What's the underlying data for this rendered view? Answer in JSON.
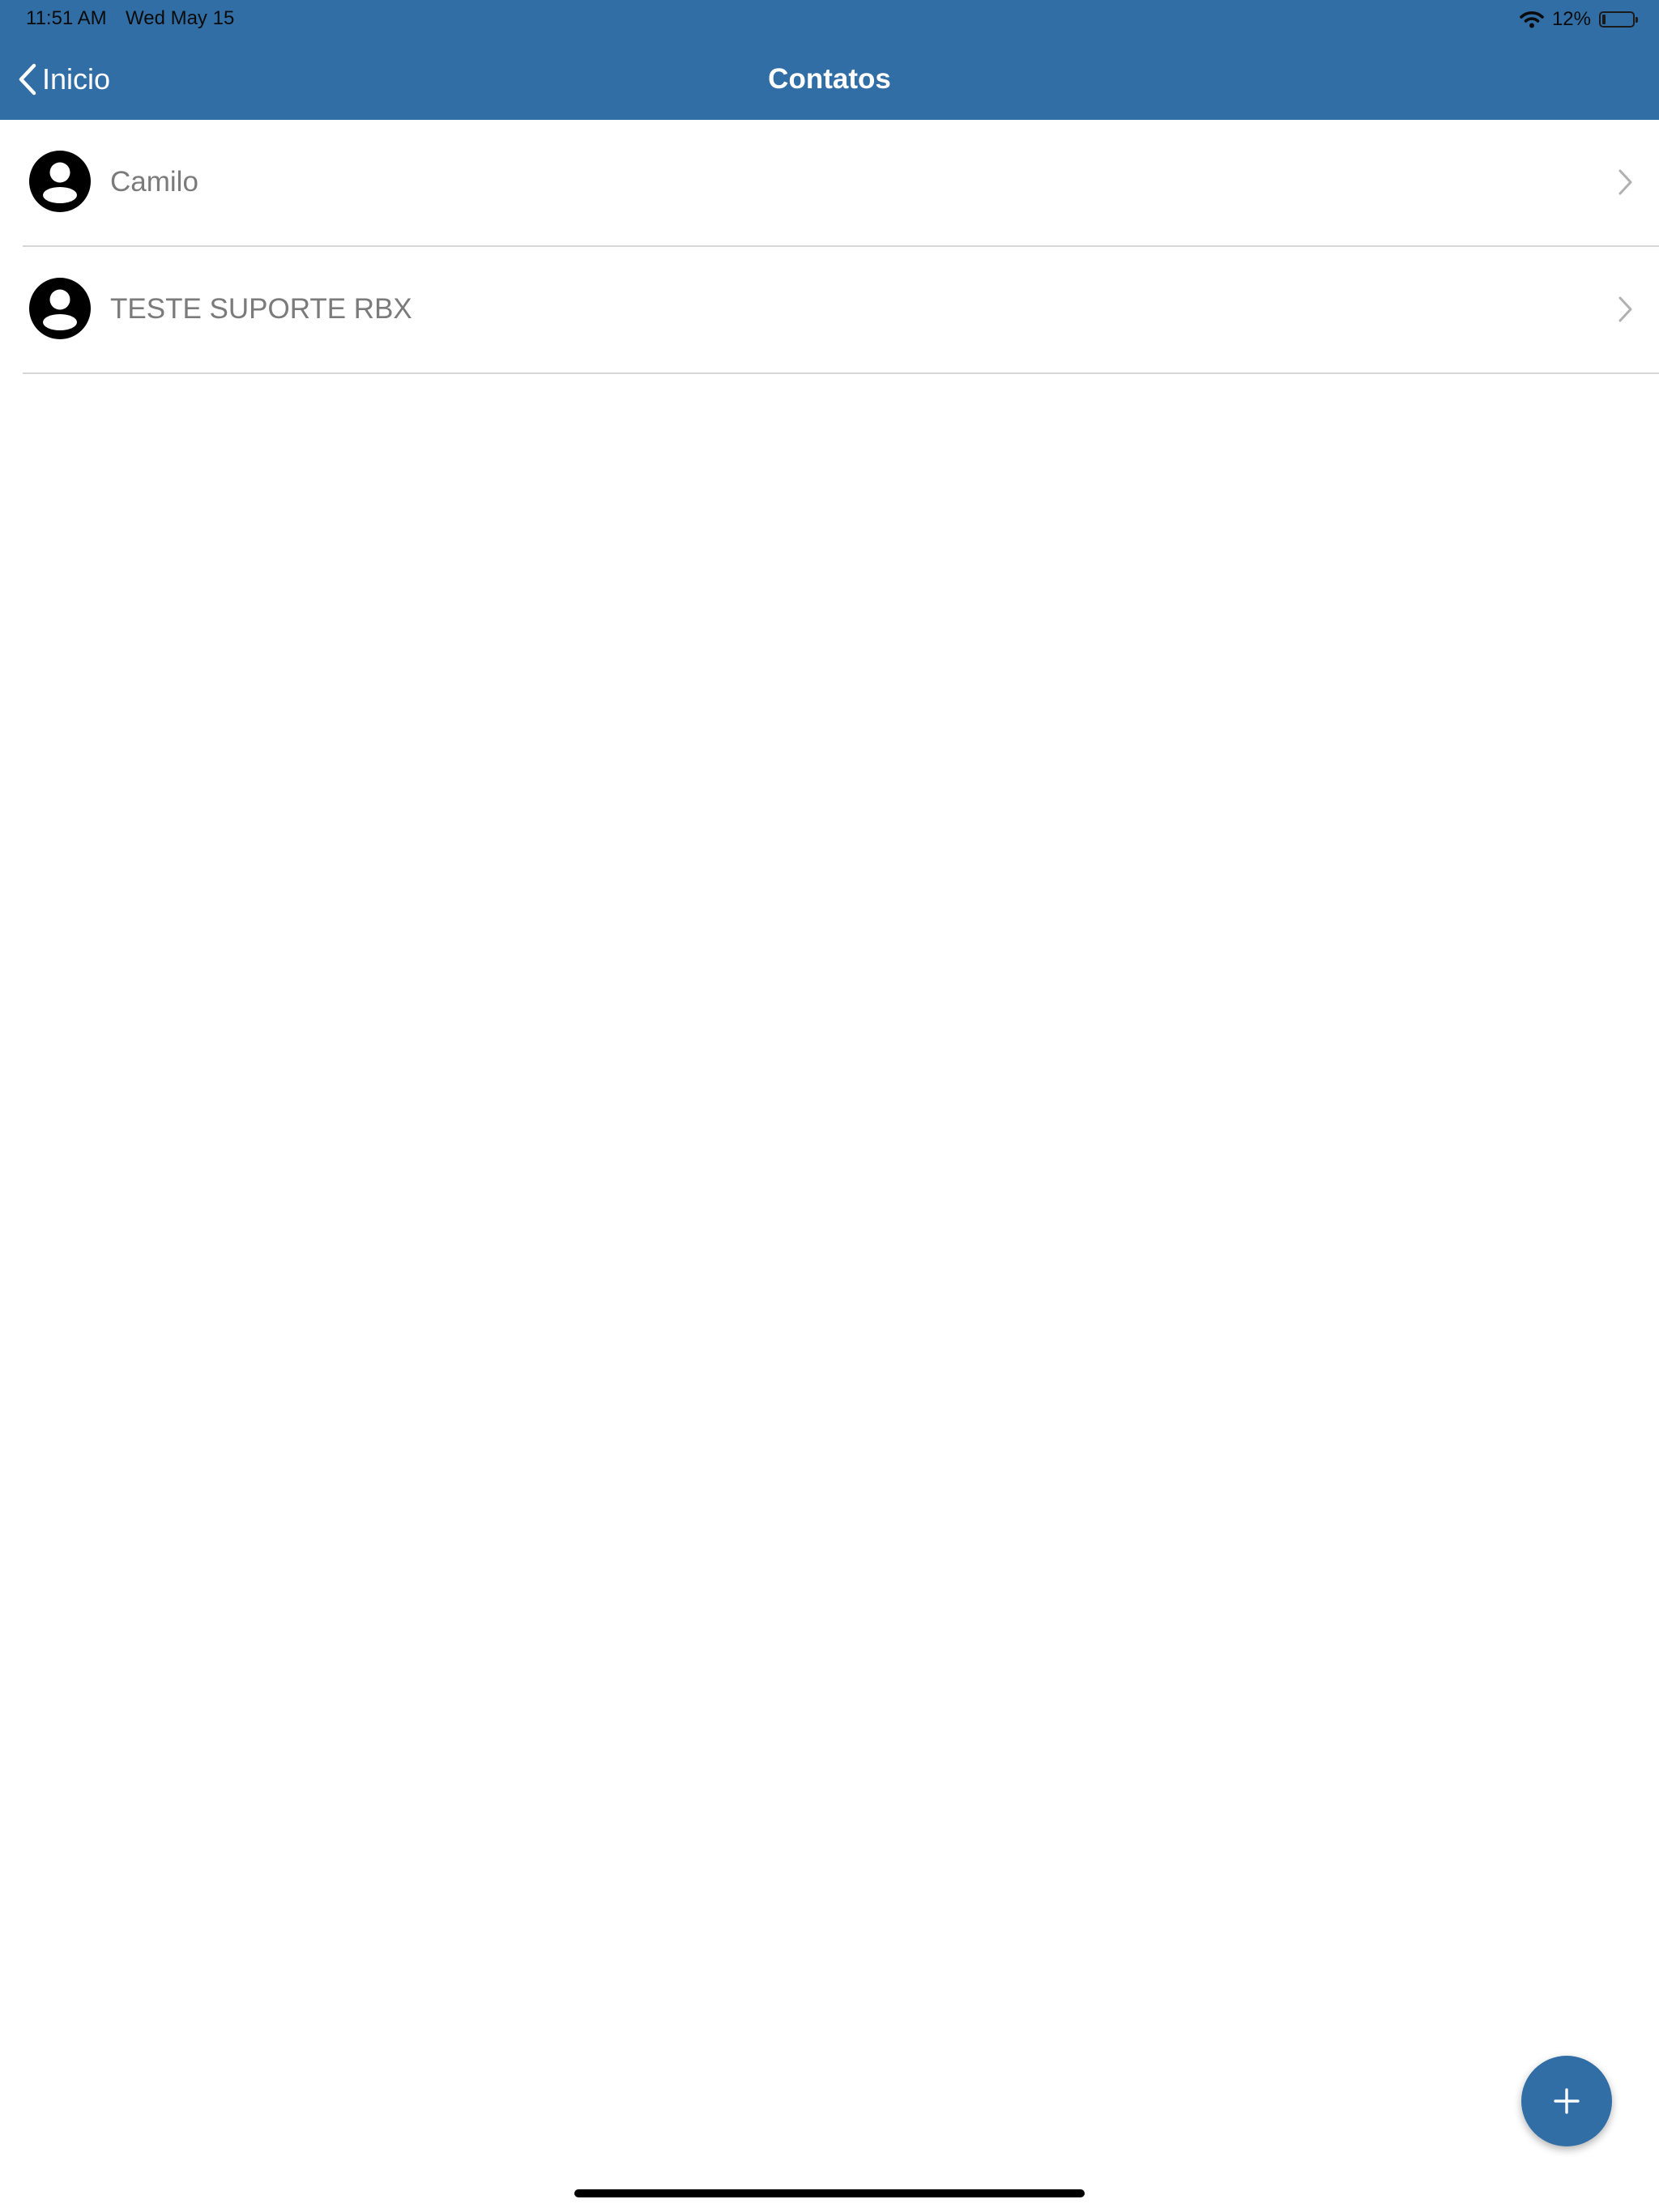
{
  "status_bar": {
    "time": "11:51 AM",
    "date": "Wed May 15",
    "battery_percent": "12%",
    "battery_level": 0.12,
    "wifi_icon": "wifi-icon",
    "battery_icon": "battery-icon"
  },
  "nav": {
    "back_label": "Inicio",
    "back_icon": "chevron-left-icon",
    "title": "Contatos"
  },
  "contacts": [
    {
      "name": "Camilo",
      "icon": "person-circle-icon"
    },
    {
      "name": "TESTE SUPORTE RBX",
      "icon": "person-circle-icon"
    }
  ],
  "fab": {
    "icon": "plus-icon"
  },
  "colors": {
    "header": "#316ea6",
    "fab": "#316ea6",
    "contact_text": "#7b7b7b",
    "divider": "#d6d6d6",
    "chevron": "#b0b0b0"
  }
}
